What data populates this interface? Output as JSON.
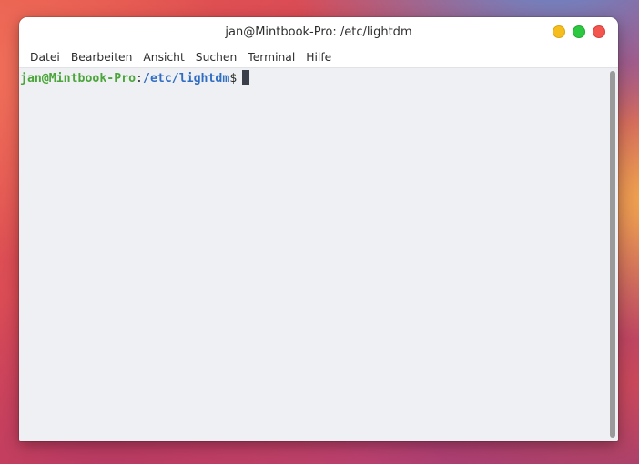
{
  "window": {
    "title": "jan@Mintbook-Pro: /etc/lightdm",
    "controls": {
      "minimize_color": "#f5be1d",
      "maximize_color": "#2bc840",
      "close_color": "#f3554f"
    }
  },
  "menubar": {
    "items": [
      "Datei",
      "Bearbeiten",
      "Ansicht",
      "Suchen",
      "Terminal",
      "Hilfe"
    ]
  },
  "terminal": {
    "prompt": {
      "user_host": "jan@Mintbook-Pro",
      "separator": ":",
      "path": "/etc/lightdm",
      "symbol": "$"
    },
    "colors": {
      "user_host": "#4aa53a",
      "path": "#2f6dc4",
      "background": "#eff0f3"
    }
  }
}
